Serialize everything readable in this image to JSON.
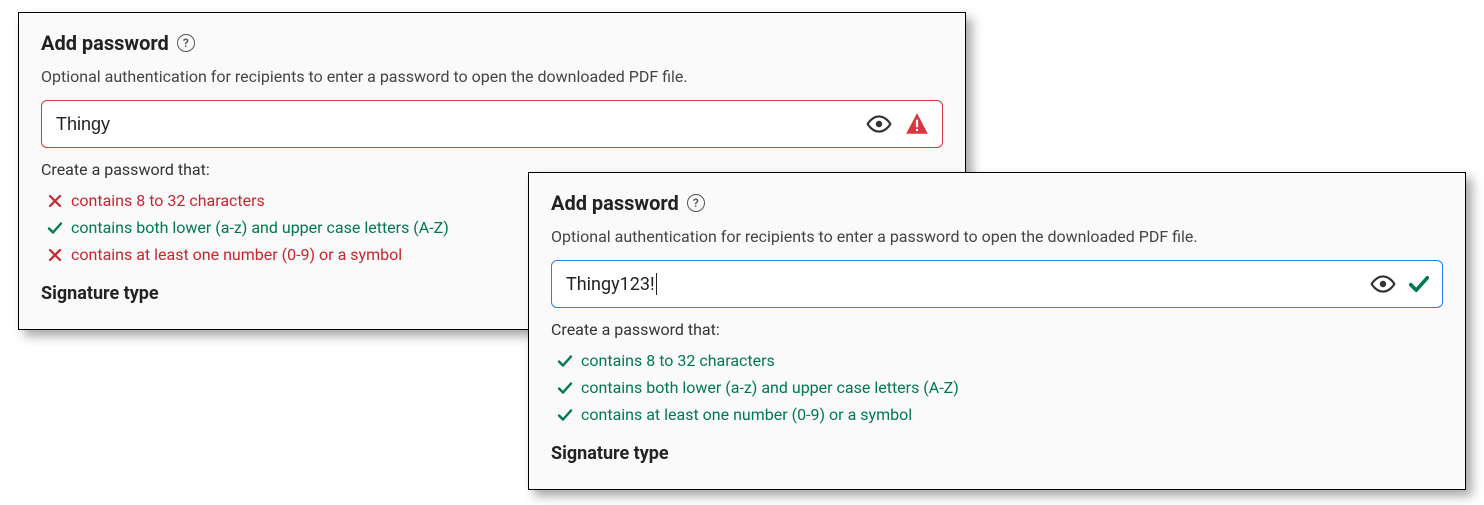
{
  "panel1": {
    "heading": "Add password",
    "subtext": "Optional authentication for recipients to enter a password to open the downloaded PDF file.",
    "inputValue": "Thingy",
    "criteriaLabel": "Create a password that:",
    "rules": [
      {
        "text": "contains 8 to 32 characters",
        "pass": false
      },
      {
        "text": "contains both lower (a-z) and upper case letters (A-Z)",
        "pass": true
      },
      {
        "text": "contains at least one number (0-9) or a symbol",
        "pass": false
      }
    ],
    "nextSection": "Signature type"
  },
  "panel2": {
    "heading": "Add password",
    "subtext": "Optional authentication for recipients to enter a password to open the downloaded PDF file.",
    "inputValue": "Thingy123!",
    "criteriaLabel": "Create a password that:",
    "rules": [
      {
        "text": "contains 8 to 32 characters",
        "pass": true
      },
      {
        "text": "contains both lower (a-z) and upper case letters (A-Z)",
        "pass": true
      },
      {
        "text": "contains at least one number (0-9) or a symbol",
        "pass": true
      }
    ],
    "nextSection": "Signature type"
  }
}
